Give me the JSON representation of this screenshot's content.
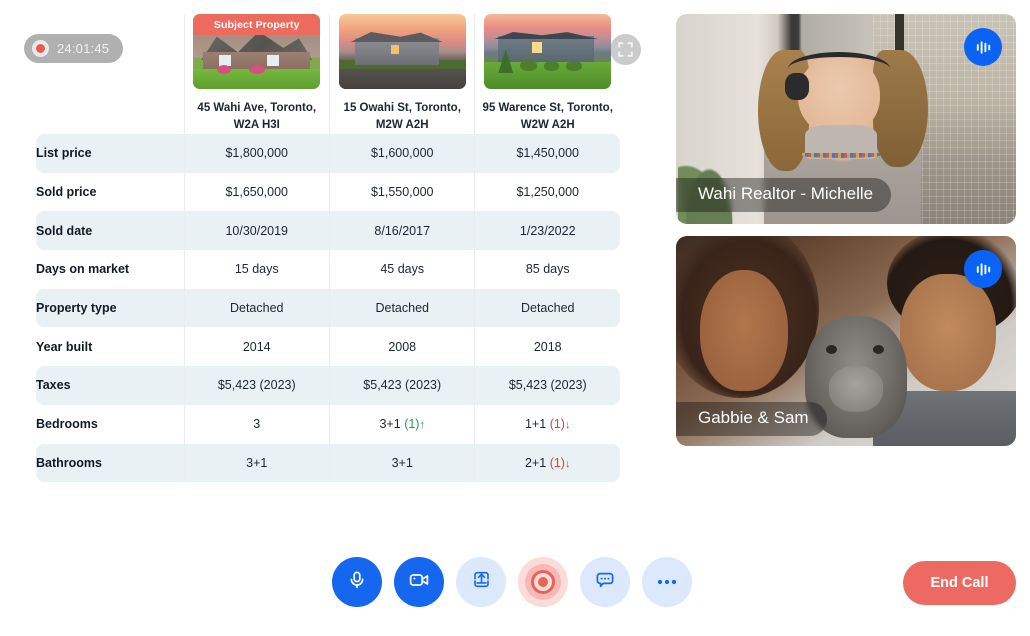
{
  "recording": {
    "timer": "24:01:45",
    "dot_icon": "record-dot-icon"
  },
  "comparison": {
    "expand_icon": "expand-fullscreen-icon",
    "subject_badge": "Subject Property",
    "properties": [
      {
        "address_line1": "45 Wahi Ave, Toronto,",
        "address_line2": "W2A H3I",
        "is_subject": true
      },
      {
        "address_line1": "15 Owahi St, Toronto,",
        "address_line2": "M2W A2H",
        "is_subject": false
      },
      {
        "address_line1": "95 Warence St, Toronto,",
        "address_line2": "W2W A2H",
        "is_subject": false
      }
    ],
    "rows": [
      {
        "label": "List price",
        "values": [
          "$1,800,000",
          "$1,600,000",
          "$1,450,000"
        ],
        "deltas": [
          "",
          "",
          ""
        ],
        "arrows": [
          "",
          "",
          ""
        ]
      },
      {
        "label": "Sold price",
        "values": [
          "$1,650,000",
          "$1,550,000",
          "$1,250,000"
        ],
        "deltas": [
          "",
          "",
          ""
        ],
        "arrows": [
          "",
          "",
          ""
        ]
      },
      {
        "label": "Sold date",
        "values": [
          "10/30/2019",
          "8/16/2017",
          "1/23/2022"
        ],
        "deltas": [
          "",
          "",
          ""
        ],
        "arrows": [
          "",
          "",
          ""
        ]
      },
      {
        "label": "Days on market",
        "values": [
          "15 days",
          "45 days",
          "85 days"
        ],
        "deltas": [
          "",
          "",
          ""
        ],
        "arrows": [
          "",
          "",
          ""
        ]
      },
      {
        "label": "Property type",
        "values": [
          "Detached",
          "Detached",
          "Detached"
        ],
        "deltas": [
          "",
          "",
          ""
        ],
        "arrows": [
          "",
          "",
          ""
        ]
      },
      {
        "label": "Year built",
        "values": [
          "2014",
          "2008",
          "2018"
        ],
        "deltas": [
          "",
          "",
          ""
        ],
        "arrows": [
          "",
          "",
          ""
        ]
      },
      {
        "label": "Taxes",
        "values": [
          "$5,423 (2023)",
          "$5,423 (2023)",
          "$5,423 (2023)"
        ],
        "deltas": [
          "",
          "",
          ""
        ],
        "arrows": [
          "",
          "",
          ""
        ]
      },
      {
        "label": "Bedrooms",
        "values": [
          "3",
          "3+1",
          "1+1"
        ],
        "deltas": [
          "",
          "(1)",
          "(1)"
        ],
        "arrows": [
          "",
          "↑",
          "↓"
        ]
      },
      {
        "label": "Bathrooms",
        "values": [
          "3+1",
          "3+1",
          "2+1"
        ],
        "deltas": [
          "",
          "",
          "(1)"
        ],
        "arrows": [
          "",
          "",
          "↓"
        ]
      }
    ]
  },
  "participants": [
    {
      "name": "Wahi Realtor - Michelle",
      "audio_icon": "audio-waveform-icon"
    },
    {
      "name": "Gabbie & Sam",
      "audio_icon": "audio-waveform-icon"
    }
  ],
  "controls": [
    {
      "name": "microphone",
      "icon": "microphone-icon",
      "style": "solid"
    },
    {
      "name": "camera",
      "icon": "video-camera-icon",
      "style": "solid"
    },
    {
      "name": "share",
      "icon": "share-upload-icon",
      "style": "light"
    },
    {
      "name": "record",
      "icon": "record-icon",
      "style": "record"
    },
    {
      "name": "chat",
      "icon": "chat-bubble-icon",
      "style": "light"
    },
    {
      "name": "more",
      "icon": "more-ellipsis-icon",
      "style": "light"
    }
  ],
  "end_call": {
    "label": "End Call"
  },
  "colors": {
    "accent_blue": "#1567f0",
    "light_blue": "#dce8fb",
    "red": "#ec6a62",
    "subject_banner": "#ec6a5e",
    "row_shade": "#eaf1f4",
    "delta_up": "#1f9d55",
    "delta_down": "#e23b34"
  }
}
